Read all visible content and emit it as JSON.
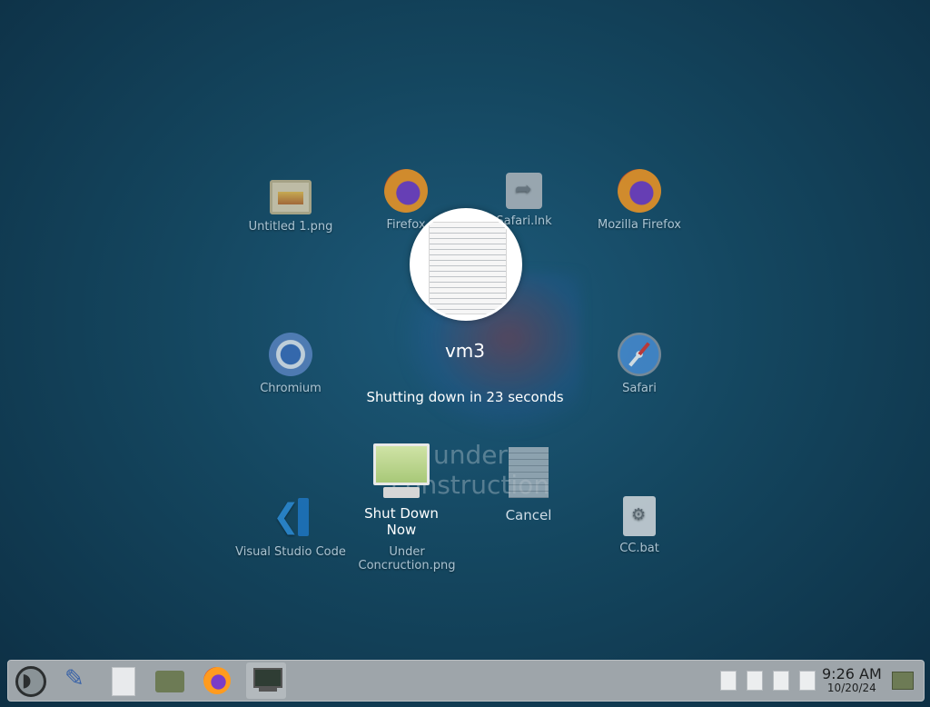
{
  "desktop": {
    "icons": [
      {
        "label": "Untitled 1.png",
        "icon": "image-icon"
      },
      {
        "label": "Firefox",
        "icon": "firefox-icon"
      },
      {
        "label": "Safari.lnk",
        "icon": "shortcut-icon"
      },
      {
        "label": "Mozilla Firefox",
        "icon": "firefox-icon"
      },
      {
        "label": "Chromium",
        "icon": "chromium-icon"
      },
      {
        "label": "Safari",
        "icon": "safari-icon"
      },
      {
        "label": "Visual Studio Code",
        "icon": "vscode-icon"
      },
      {
        "label": "Under Concruction.png",
        "icon": "image-icon"
      },
      {
        "label": "CC.bat",
        "icon": "batch-file-icon"
      }
    ],
    "wallpaper_text": "under construction"
  },
  "shutdown_dialog": {
    "host": "vm3",
    "countdown": "Shutting down in 23 seconds",
    "shutdown_label": "Shut Down Now",
    "cancel_label": "Cancel"
  },
  "taskbar": {
    "launchers": [
      {
        "icon": "start-menu-icon"
      },
      {
        "icon": "settings-icon"
      },
      {
        "icon": "text-file-icon"
      },
      {
        "icon": "folder-icon"
      },
      {
        "icon": "firefox-icon"
      },
      {
        "icon": "terminal-icon"
      }
    ],
    "clock": {
      "time": "9:26 AM",
      "date": "10/20/24"
    }
  }
}
